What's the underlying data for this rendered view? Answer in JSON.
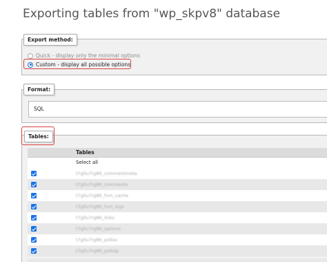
{
  "page": {
    "title": "Exporting tables from \"wp_skpv8\" database"
  },
  "export_method": {
    "legend": "Export method:",
    "options": [
      {
        "label": "Quick - display only the minimal options",
        "checked": false
      },
      {
        "label": "Custom - display all possible options",
        "checked": true
      }
    ]
  },
  "format": {
    "legend": "Format:",
    "selected": "SQL"
  },
  "tables": {
    "legend": "Tables:",
    "column_header": "Tables",
    "select_all": "Select all",
    "rows": [
      {
        "name": "t7gllu7rg86_commentmeta",
        "checked": true
      },
      {
        "name": "t7gllu7rg86_comments",
        "checked": true
      },
      {
        "name": "t7gllu7rg86_fvm_cache",
        "checked": true
      },
      {
        "name": "t7gllu7rg86_fvm_logs",
        "checked": true
      },
      {
        "name": "t7gllu7rg86_links",
        "checked": true
      },
      {
        "name": "t7gllu7rg86_options",
        "checked": true
      },
      {
        "name": "t7gllu7rg86_pollas",
        "checked": true
      },
      {
        "name": "t7gllu7rg86_pollsip",
        "checked": true
      }
    ]
  },
  "colors": {
    "highlight": "#d94040",
    "checkbox": "#1a73e8",
    "panel_bg": "#f1f1f1"
  }
}
